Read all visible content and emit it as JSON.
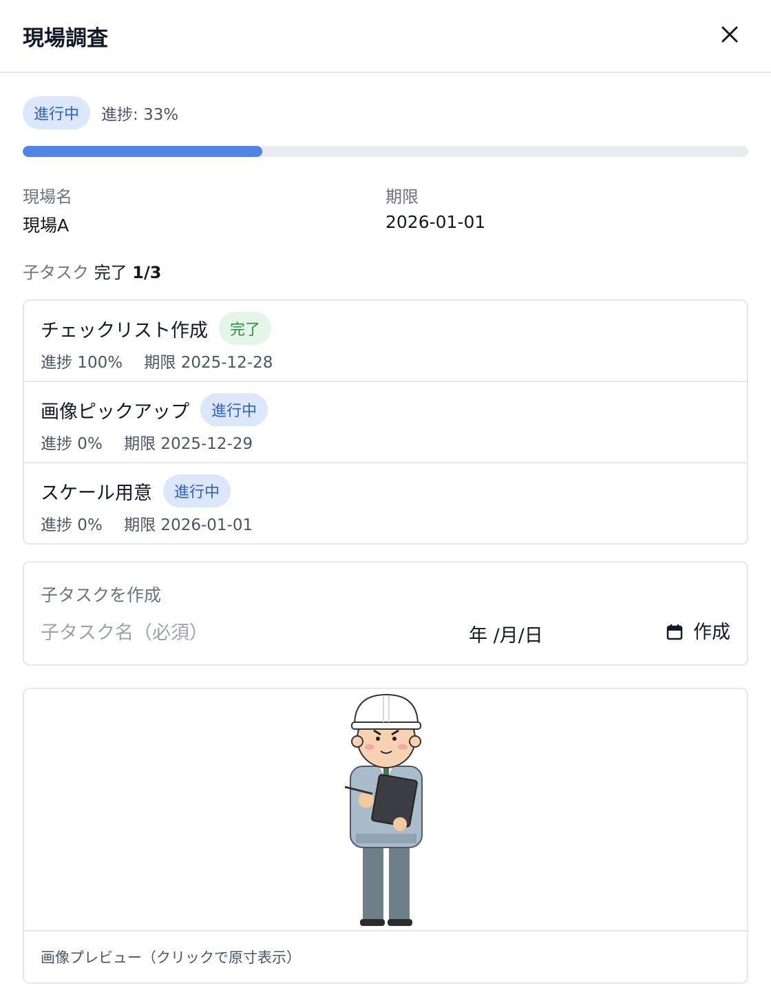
{
  "header": {
    "title": "現場調査"
  },
  "status": {
    "badge": "進行中",
    "progress_text": "進捗: 33%",
    "progress_percent": 33
  },
  "info": {
    "site_label": "現場名",
    "site_value": "現場A",
    "due_label": "期限",
    "due_value": "2026-01-01"
  },
  "subtasks": {
    "summary_label": "子タスク",
    "summary_done_label": "完了",
    "summary_count": "1/3",
    "items": [
      {
        "name": "チェックリスト作成",
        "status": "完了",
        "progress": "進捗 100%",
        "due": "期限 2025-12-28"
      },
      {
        "name": "画像ピックアップ",
        "status": "進行中",
        "progress": "進捗 0%",
        "due": "期限 2025-12-29"
      },
      {
        "name": "スケール用意",
        "status": "進行中",
        "progress": "進捗 0%",
        "due": "期限 2026-01-01"
      }
    ]
  },
  "create": {
    "title": "子タスクを作成",
    "name_placeholder": "子タスク名（必須）",
    "date_placeholder": "年 /月/日",
    "button_label": "作成"
  },
  "preview": {
    "caption": "画像プレビュー（クリックで原寸表示）"
  },
  "colors": {
    "accent": "#4f84ea",
    "badge_progress_bg": "#dbe7fb",
    "badge_done_bg": "#e3f6e8"
  },
  "icons": {
    "close": "close-icon",
    "calendar": "calendar-icon"
  }
}
